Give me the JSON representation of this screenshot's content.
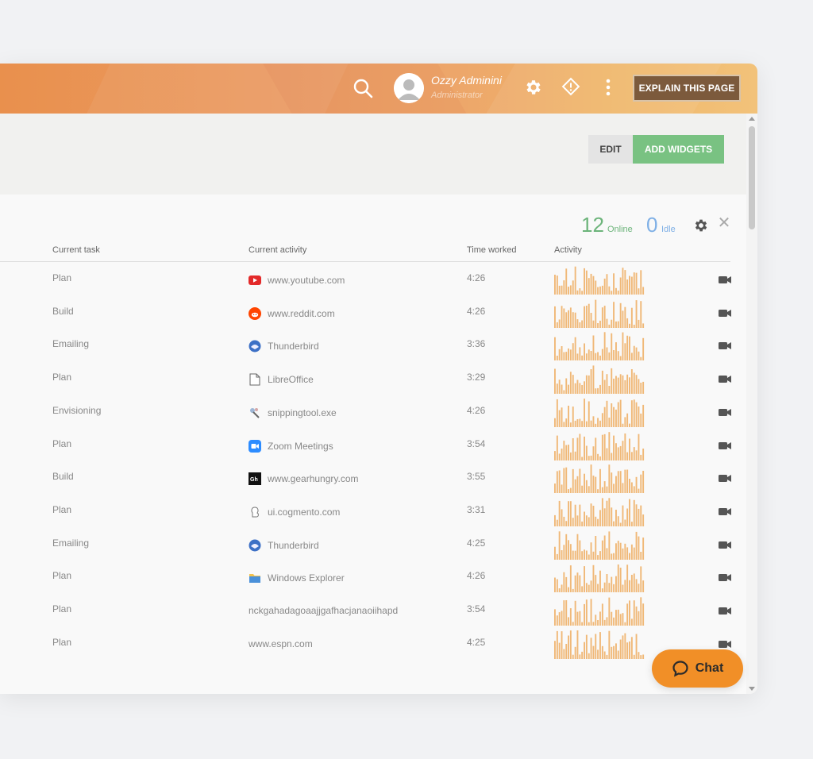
{
  "topbar": {
    "user_name": "Ozzy Adminini",
    "user_role": "Administrator",
    "explain_label": "EXPLAIN THIS PAGE"
  },
  "toolbar": {
    "edit_label": "EDIT",
    "add_widgets_label": "ADD WIDGETS"
  },
  "stats": {
    "online_count": "12",
    "online_label": "Online",
    "idle_count": "0",
    "idle_label": "Idle"
  },
  "table": {
    "columns": [
      "Current task",
      "Current activity",
      "Time worked",
      "Activity"
    ],
    "rows": [
      {
        "task": "Plan",
        "activity": "www.youtube.com",
        "icon": "youtube-icon",
        "time": "4:26"
      },
      {
        "task": "Build",
        "activity": "www.reddit.com",
        "icon": "reddit-icon",
        "time": "4:26"
      },
      {
        "task": "Emailing",
        "activity": "Thunderbird",
        "icon": "thunderbird-icon",
        "time": "3:36"
      },
      {
        "task": "Plan",
        "activity": "LibreOffice",
        "icon": "libreoffice-icon",
        "time": "3:29"
      },
      {
        "task": "Envisioning",
        "activity": "snippingtool.exe",
        "icon": "snippingtool-icon",
        "time": "4:26"
      },
      {
        "task": "Plan",
        "activity": "Zoom Meetings",
        "icon": "zoom-icon",
        "time": "3:54"
      },
      {
        "task": "Build",
        "activity": "www.gearhungry.com",
        "icon": "gearhungry-icon",
        "time": "3:55"
      },
      {
        "task": "Plan",
        "activity": "ui.cogmento.com",
        "icon": "cogmento-icon",
        "time": "3:31"
      },
      {
        "task": "Emailing",
        "activity": "Thunderbird",
        "icon": "thunderbird-icon",
        "time": "4:25"
      },
      {
        "task": "Plan",
        "activity": "Windows Explorer",
        "icon": "folder-icon",
        "time": "4:26"
      },
      {
        "task": "Plan",
        "activity": "nckgahadagoaajjgafhacjanaoiihapd",
        "icon": "",
        "time": "3:54"
      },
      {
        "task": "Plan",
        "activity": "www.espn.com",
        "icon": "",
        "time": "4:25"
      }
    ]
  },
  "chat": {
    "label": "Chat"
  },
  "colors": {
    "accent_orange": "#f18f27",
    "online_green": "#6cb47a",
    "idle_blue": "#7fb0e6",
    "add_widgets_green": "#79c282",
    "sparkline": "#f0b877"
  }
}
